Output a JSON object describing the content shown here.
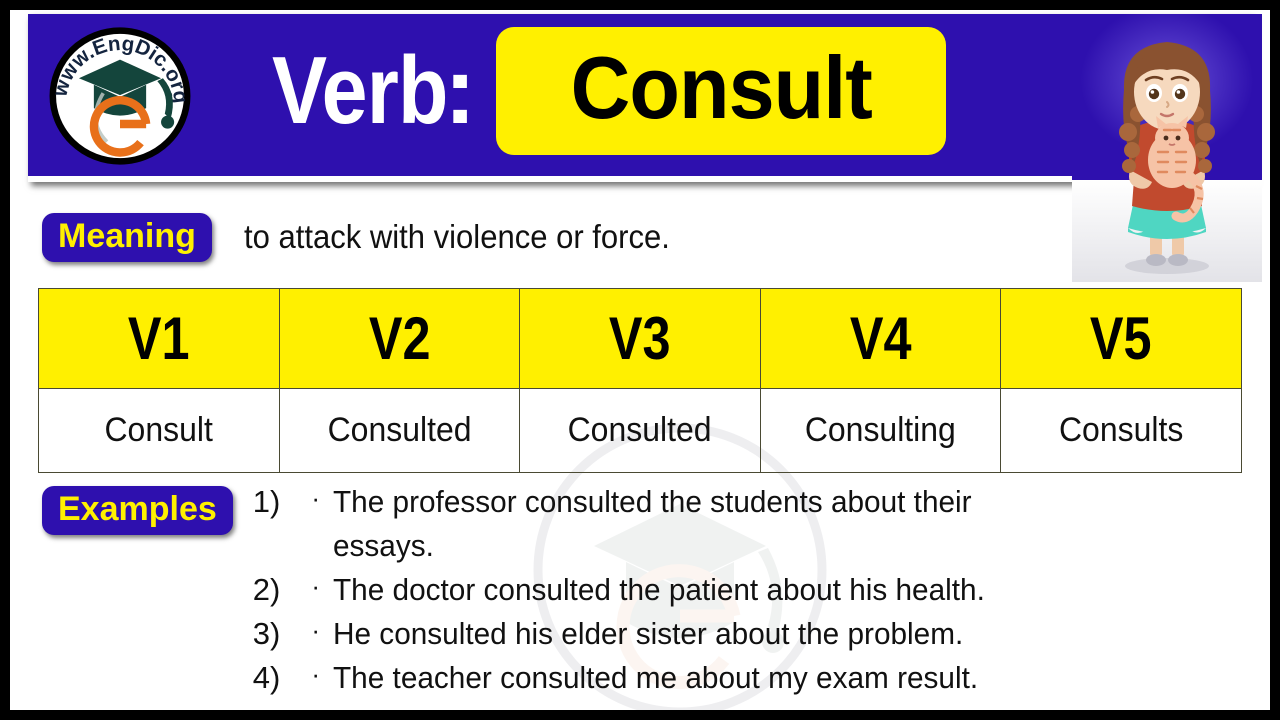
{
  "header": {
    "logo_alt": "www.EngDic.org",
    "logo_text_top": "www.EngDic.org",
    "logo_letter": "e",
    "part_of_speech": "Verb",
    "colon": ":",
    "word": "Consult",
    "illustration_alt": "girl-holding-cat"
  },
  "meaning": {
    "label": "Meaning",
    "text": "to attack with violence or force."
  },
  "table": {
    "headers": [
      "V1",
      "V2",
      "V3",
      "V4",
      "V5"
    ],
    "forms": [
      "Consult",
      "Consulted",
      "Consulted",
      "Consulting",
      "Consults"
    ]
  },
  "examples": {
    "label": "Examples",
    "items": [
      {
        "num": "1)",
        "bullet": "·",
        "text": "The professor consulted the students about their essays."
      },
      {
        "num": "2)",
        "bullet": "·",
        "text": "The doctor consulted the patient about his health."
      },
      {
        "num": "3)",
        "bullet": "·",
        "text": "He consulted his elder sister about the problem."
      },
      {
        "num": "4)",
        "bullet": "·",
        "text": "The teacher consulted me about my exam result."
      }
    ]
  },
  "watermark": {
    "text": "www.EngDic.org"
  },
  "colors": {
    "banner_blue": "#2E10AE",
    "accent_yellow": "#FFF000",
    "frame_black": "#000000",
    "text_black": "#111111",
    "cap_green": "#14453C",
    "letter_orange": "#E8701A"
  }
}
